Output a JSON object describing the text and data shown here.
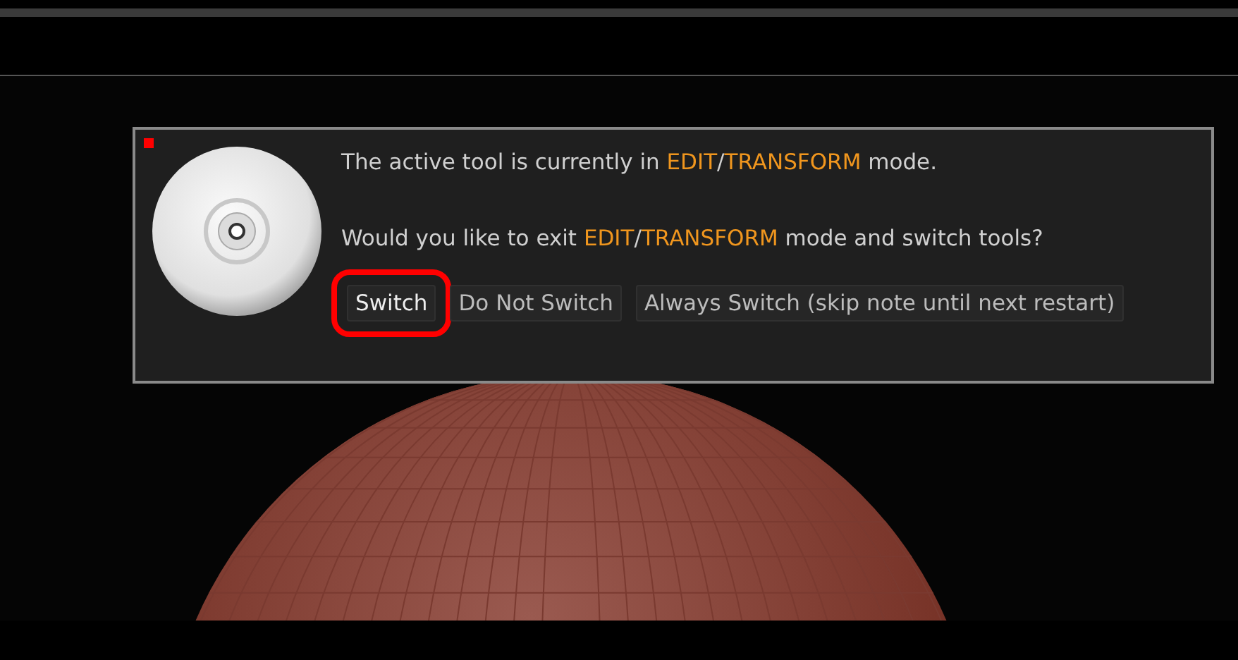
{
  "dialog": {
    "lines": [
      [
        {
          "kind": "plain",
          "text": "The active tool is currently in "
        },
        {
          "kind": "accent",
          "text": "EDIT"
        },
        {
          "kind": "plain",
          "text": "/"
        },
        {
          "kind": "accent",
          "text": "TRANSFORM"
        },
        {
          "kind": "plain",
          "text": " mode."
        }
      ],
      [
        {
          "kind": "plain",
          "text": "Would you like to exit "
        },
        {
          "kind": "accent",
          "text": "EDIT"
        },
        {
          "kind": "plain",
          "text": "/"
        },
        {
          "kind": "accent",
          "text": "TRANSFORM"
        },
        {
          "kind": "plain",
          "text": " mode and switch tools?"
        }
      ]
    ],
    "buttons": [
      {
        "label": "Switch",
        "highlighted": true
      },
      {
        "label": "Do Not Switch",
        "highlighted": false
      },
      {
        "label": "Always Switch (skip note until next restart)",
        "highlighted": false
      }
    ]
  }
}
